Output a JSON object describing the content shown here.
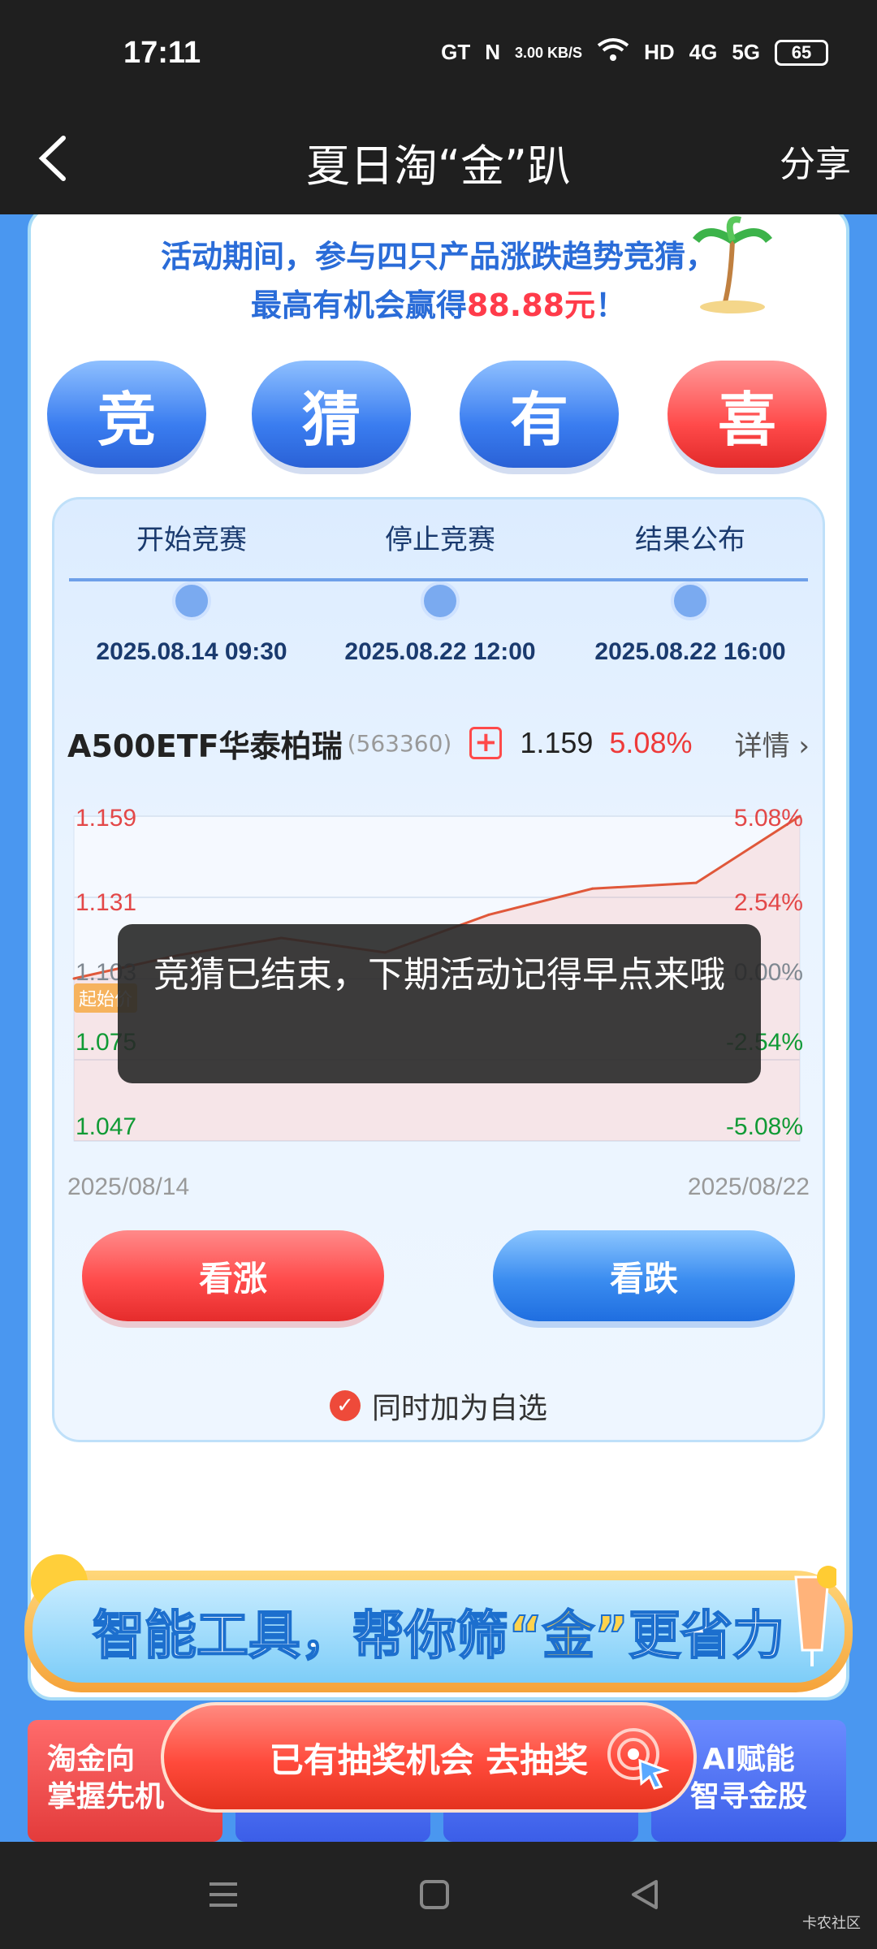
{
  "status": {
    "time": "17:11",
    "network_speed": "3.00 KB/S",
    "battery": "65",
    "signal_labels": [
      "GT",
      "N",
      "HD",
      "4G",
      "5G"
    ]
  },
  "header": {
    "title": "夏日淘“金”趴",
    "share_label": "分享"
  },
  "notice": {
    "line1": "活动期间，参与四只产品涨跌趋势竞猜，",
    "line2_prefix": "最高有机会赢得",
    "line2_amount": "88.88元",
    "line2_suffix": "！"
  },
  "big_buttons": [
    "竞",
    "猜",
    "有",
    "喜"
  ],
  "timeline": [
    {
      "label": "开始竞赛",
      "date": "2025.08.14 09:30"
    },
    {
      "label": "停止竞赛",
      "date": "2025.08.22 12:00"
    },
    {
      "label": "结果公布",
      "date": "2025.08.22 16:00"
    }
  ],
  "stock": {
    "name": "A500ETF华泰柏瑞",
    "code": "(563360)",
    "add_icon": "+",
    "price": "1.159",
    "change_pct": "5.08%",
    "detail_label": "详情"
  },
  "chart_data": {
    "type": "line",
    "x_start": "2025/08/14",
    "x_end": "2025/08/22",
    "y_ticks_left": [
      "1.159",
      "1.131",
      "1.103",
      "1.075",
      "1.047"
    ],
    "y_ticks_right": [
      "5.08%",
      "2.54%",
      "0.00%",
      "-2.54%",
      "-5.08%"
    ],
    "ylim": [
      1.047,
      1.159
    ],
    "series": [
      {
        "values": [
          1.103,
          1.111,
          1.117,
          1.112,
          1.125,
          1.134,
          1.136,
          1.159
        ]
      }
    ],
    "start_badge": "起始价",
    "colors": {
      "line": "#e0583a",
      "up": "#e34848",
      "flat": "#7f8891",
      "down": "#109a35"
    }
  },
  "actions": {
    "up_label": "看涨",
    "down_label": "看跌",
    "add_watch_label": "同时加为自选"
  },
  "toast": {
    "text": "竞猜已结束，下期活动记得早点来哦"
  },
  "tools_banner": {
    "text_prefix": "智能工具，帮你筛",
    "text_highlight": "“金”",
    "text_suffix": "更省力"
  },
  "tiles": {
    "left_line1": "淘金向",
    "left_line2": "掌握先机",
    "right_line1": "AI赋能",
    "right_line2": "智寻金股"
  },
  "lottery": {
    "label": "已有抽奖机会 去抽奖"
  },
  "watermark": "卡农社区"
}
